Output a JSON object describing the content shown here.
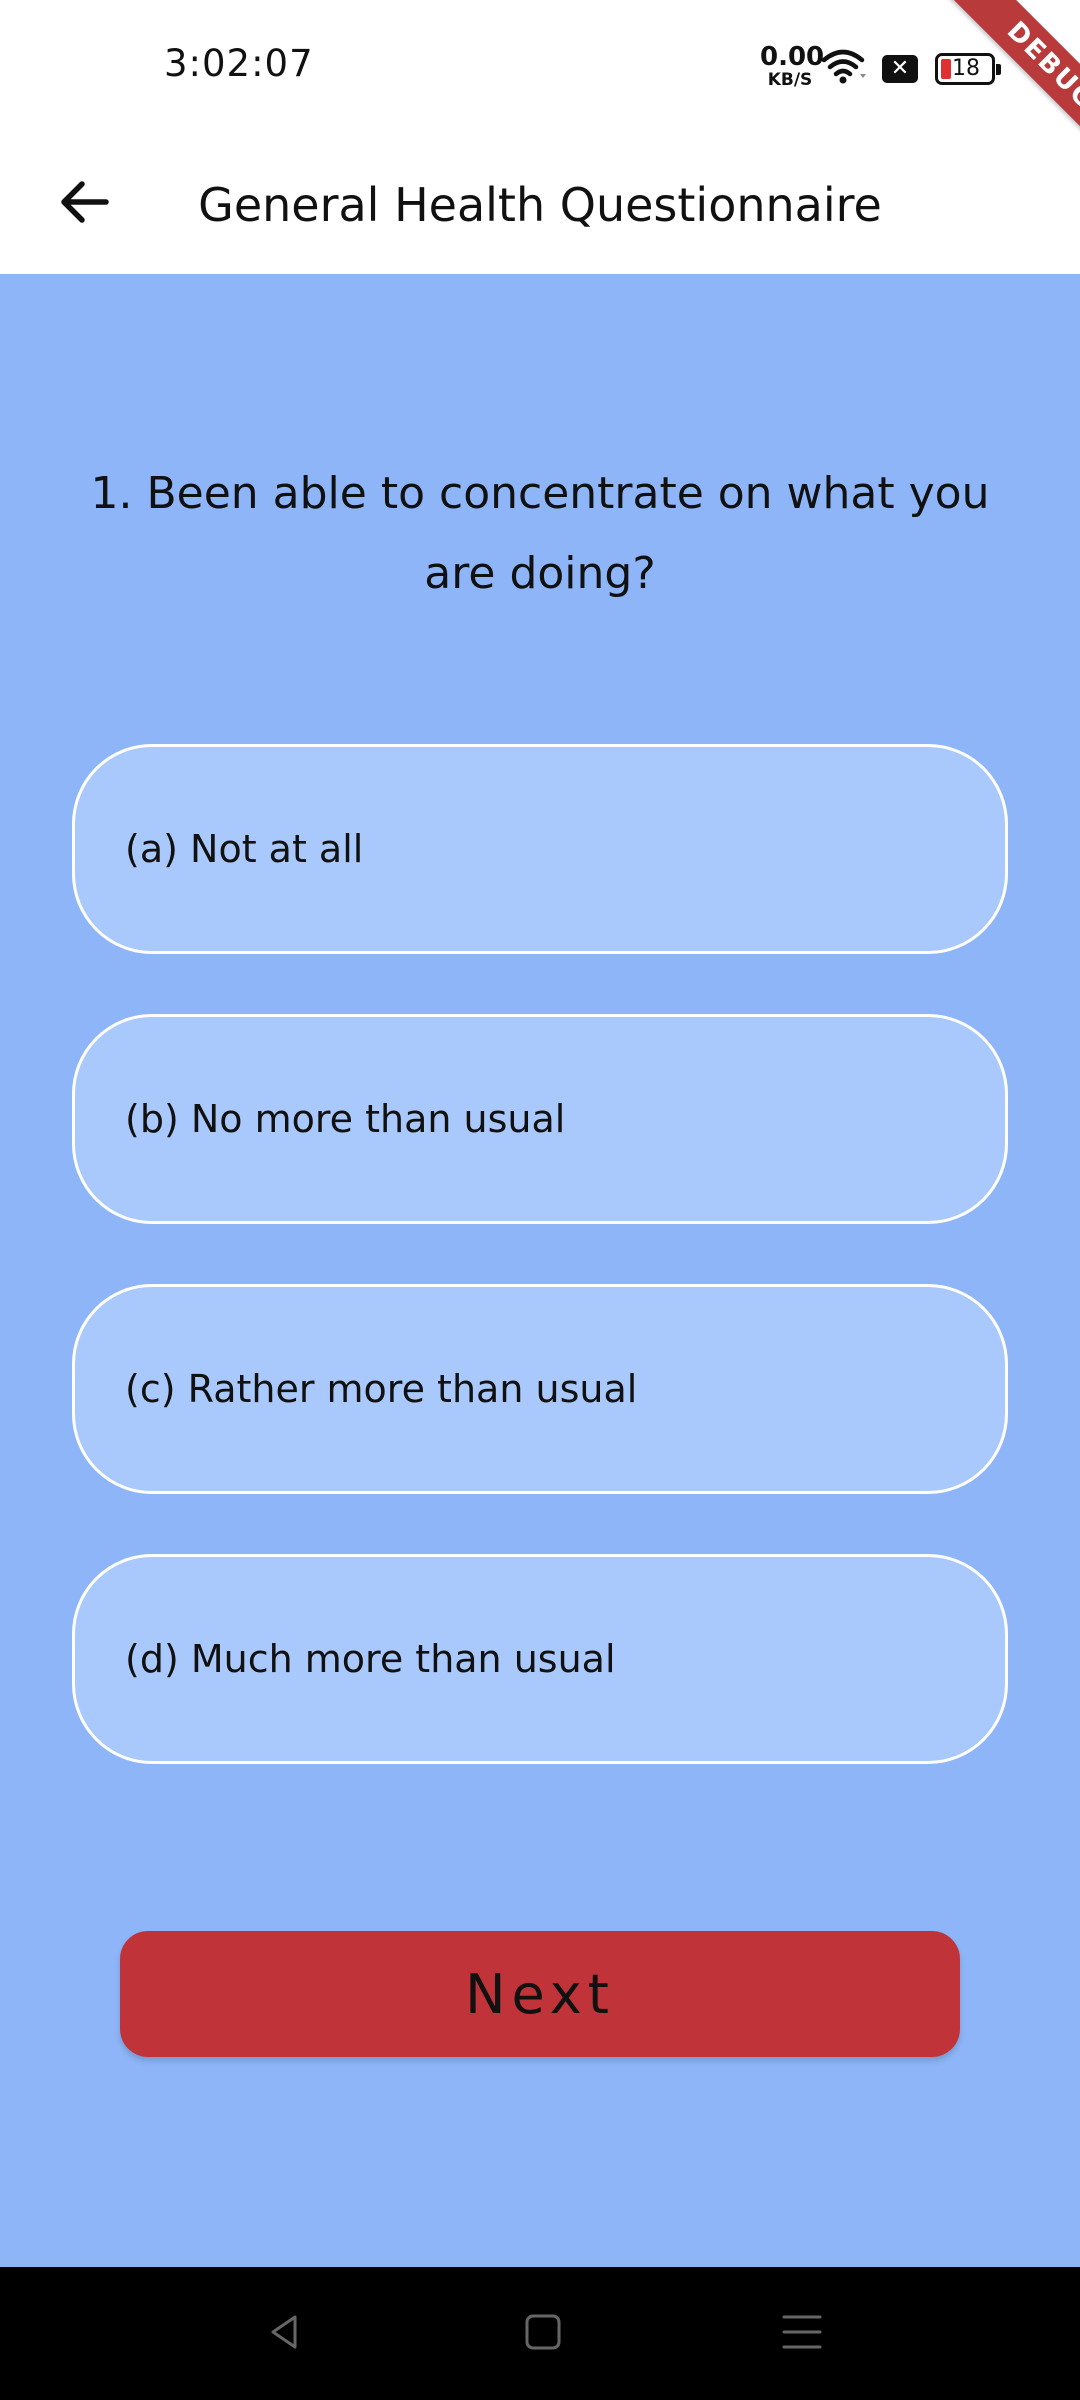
{
  "status_bar": {
    "time": "3:02:07",
    "speed_value": "0.00",
    "speed_unit": "KB/S",
    "battery_level": "18",
    "debug_label": "DEBUG"
  },
  "app_bar": {
    "title": "General Health Questionnaire",
    "back_icon": "arrow-left-icon"
  },
  "question": {
    "text": "1. Been able to concentrate on what you are doing?"
  },
  "options": [
    {
      "label": "(a) Not at all"
    },
    {
      "label": "(b) No more than usual"
    },
    {
      "label": "(c) Rather more than usual"
    },
    {
      "label": "(d) Much more than usual"
    }
  ],
  "next_button": {
    "label": "Next"
  },
  "colors": {
    "background": "#8db5f8",
    "option_fill": "#a9c8fb",
    "option_border": "#ffffff",
    "next_button": "#c03338"
  },
  "nav_bar": {
    "icons": [
      "nav-back-icon",
      "nav-home-icon",
      "nav-menu-icon"
    ]
  }
}
